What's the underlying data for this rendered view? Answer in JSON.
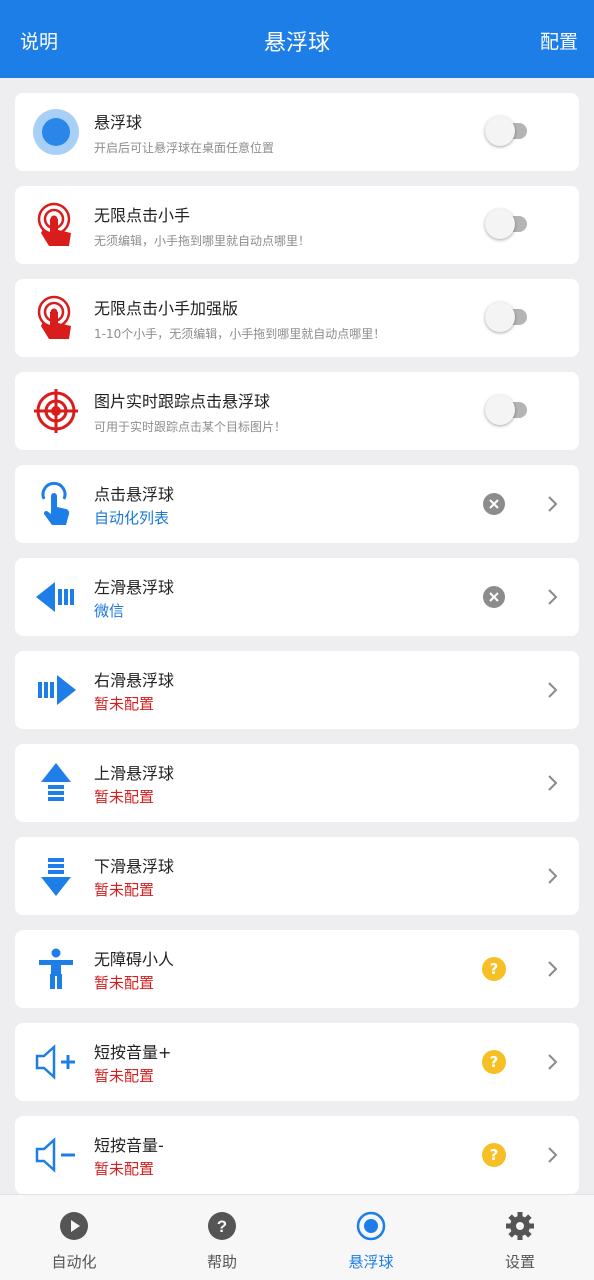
{
  "header": {
    "left": "说明",
    "title": "悬浮球",
    "right": "配置"
  },
  "items": [
    {
      "title": "悬浮球",
      "sub": "开启后可让悬浮球在桌面任意位置",
      "icon": "floating-ball-icon"
    },
    {
      "title": "无限点击小手",
      "sub": "无须编辑，小手拖到哪里就自动点哪里！",
      "icon": "tap-hand-icon"
    },
    {
      "title": "无限点击小手加强版",
      "sub": "1-10个小手，无须编辑，小手拖到哪里就自动点哪里！",
      "icon": "tap-hand-plus-icon"
    },
    {
      "title": "图片实时跟踪点击悬浮球",
      "sub": "可用于实时跟踪点击某个目标图片！",
      "icon": "target-icon"
    },
    {
      "title": "点击悬浮球",
      "sub": "自动化列表",
      "icon": "pointer-hand-icon"
    },
    {
      "title": "左滑悬浮球",
      "sub": "微信",
      "icon": "arrow-left-icon"
    },
    {
      "title": "右滑悬浮球",
      "sub": "暂未配置",
      "icon": "arrow-right-icon"
    },
    {
      "title": "上滑悬浮球",
      "sub": "暂未配置",
      "icon": "arrow-up-icon"
    },
    {
      "title": "下滑悬浮球",
      "sub": "暂未配置",
      "icon": "arrow-down-icon"
    },
    {
      "title": "无障碍小人",
      "sub": "暂未配置",
      "icon": "accessibility-person-icon"
    },
    {
      "title": "短按音量+",
      "sub": "暂未配置",
      "icon": "volume-up-icon"
    },
    {
      "title": "短按音量-",
      "sub": "暂未配置",
      "icon": "volume-down-icon"
    }
  ],
  "tabs": [
    {
      "label": "自动化",
      "icon": "play-icon"
    },
    {
      "label": "帮助",
      "icon": "help-icon"
    },
    {
      "label": "悬浮球",
      "icon": "floating-ball-tab-icon"
    },
    {
      "label": "设置",
      "icon": "gear-icon"
    }
  ],
  "colors": {
    "primary": "#1e7ee8",
    "red": "#d31f1f",
    "warning": "#f6bf26"
  }
}
